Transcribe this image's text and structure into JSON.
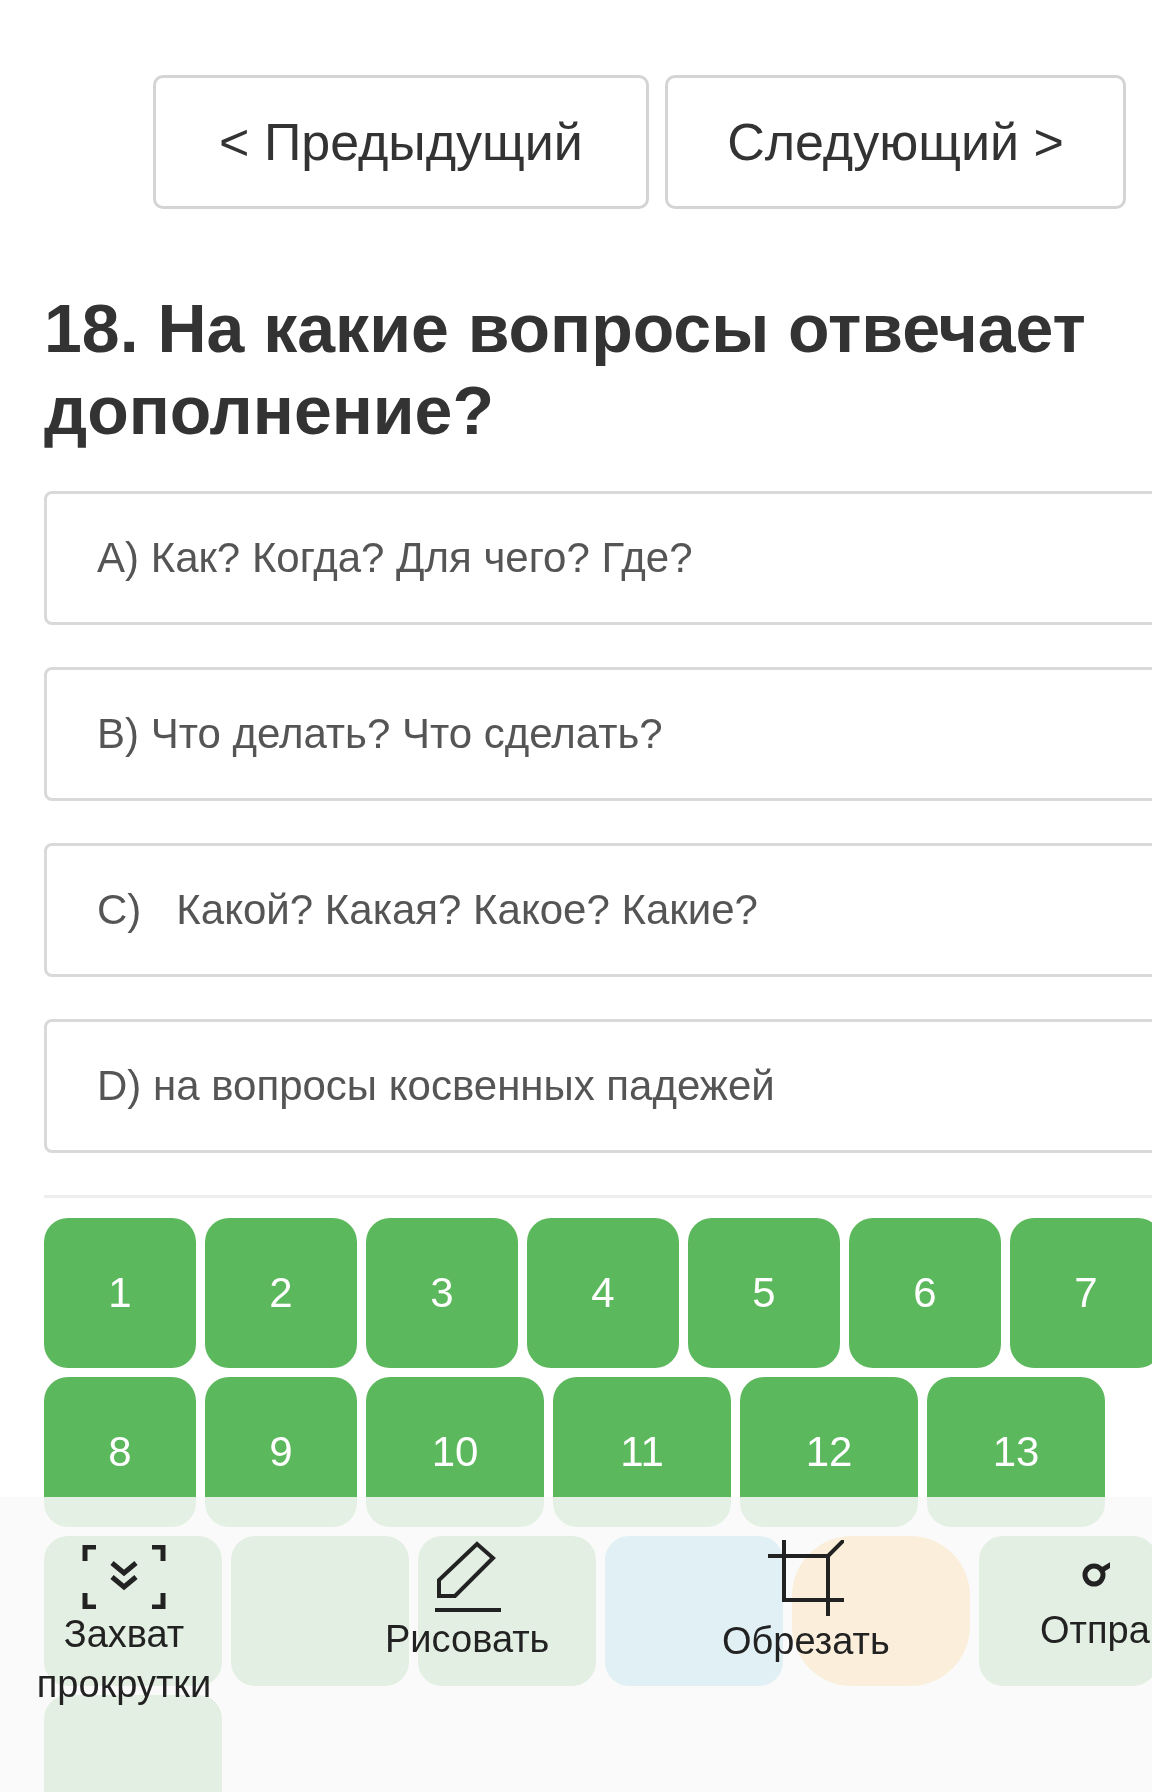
{
  "nav": [
    {
      "label": "< Предыдущий"
    },
    {
      "label": "Следующий >"
    }
  ],
  "question": {
    "title": "18. На какие вопросы отвечает дополнение?"
  },
  "options": [
    {
      "text": "A) Как? Когда? Для чего? Где?"
    },
    {
      "text": "B) Что делать? Что сделать?"
    },
    {
      "text": "C)   Какой? Какая? Какое? Какие?"
    },
    {
      "text": "D) на вопросы косвенных падежей"
    }
  ],
  "question_grid": [
    {
      "label": "1",
      "color": "#5cb85c"
    },
    {
      "label": "2",
      "color": "#5cb85c"
    },
    {
      "label": "3",
      "color": "#5cb85c"
    },
    {
      "label": "4",
      "color": "#5cb85c"
    },
    {
      "label": "5",
      "color": "#5cb85c"
    },
    {
      "label": "6",
      "color": "#5cb85c"
    },
    {
      "label": "7",
      "color": "#5cb85c"
    },
    {
      "label": "8",
      "color": "#5cb85c"
    },
    {
      "label": "9",
      "color": "#5cb85c"
    },
    {
      "label": "10",
      "color": "#5cb85c"
    },
    {
      "label": "11",
      "color": "#5cb85c"
    },
    {
      "label": "12",
      "color": "#5cb85c"
    },
    {
      "label": "13",
      "color": "#5cb85c"
    },
    {
      "color": "#e3efe3"
    },
    {
      "color": "#e3efe3"
    },
    {
      "color": "#e3efe3"
    },
    {
      "color": "#e1f0f5"
    },
    {
      "color": "#fbeedb",
      "kind": "current"
    },
    {
      "color": "#e3efe3"
    },
    {
      "color": "#e3efe3"
    }
  ],
  "screenshot_toolbar": [
    {
      "kind": "scroll",
      "label": "Захват прокрутки"
    },
    {
      "kind": "draw",
      "label": "Рисовать"
    },
    {
      "kind": "crop",
      "label": "Обрезать"
    },
    {
      "kind": "share",
      "label": "Отпра"
    }
  ]
}
